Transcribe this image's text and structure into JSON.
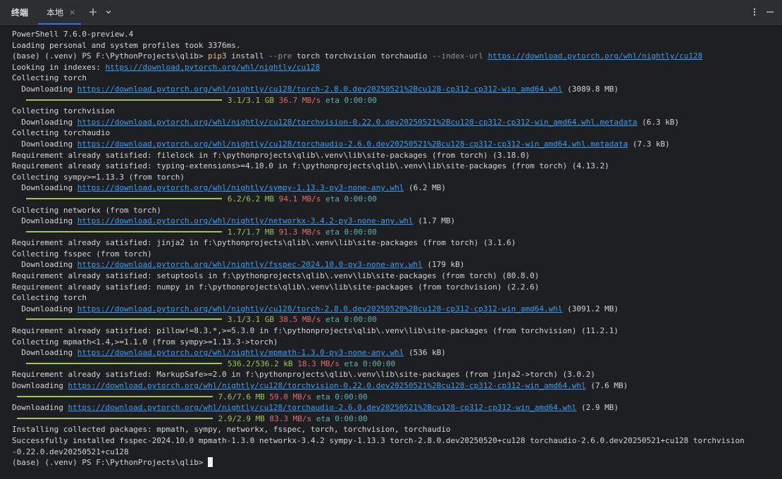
{
  "header": {
    "title": "终端",
    "tab_label": "本地",
    "close_glyph": "×",
    "new_tab_glyph": "+",
    "dropdown_glyph": "⌄",
    "more_glyph": "⋮",
    "minimize_glyph": "—"
  },
  "terminal": {
    "prompt": "(base) (.venv) PS F:\\PythonProjects\\qlib>",
    "cmd": {
      "pip": "pip3",
      "install": "install",
      "pre_flag": "--pre",
      "packages": "torch torchvision torchaudio",
      "index_flag": "--index-url",
      "index_url": "https://download.pytorch.org/whl/nightly/cu128"
    },
    "l1": "PowerShell 7.6.0-preview.4",
    "l2": "Loading personal and system profiles took 3376ms.",
    "l4_prefix": "Looking in indexes: ",
    "l4_url": "https://download.pytorch.org/whl/nightly/cu128",
    "l5": "Collecting torch",
    "dl": "Downloading",
    "u_torch1": "https://download.pytorch.org/whl/nightly/cu128/torch-2.8.0.dev20250521%2Bcu128-cp312-cp312-win_amd64.whl",
    "s_torch1": " (3089.8 MB)",
    "p_torch1": {
      "size": "3.1/3.1 GB",
      "rate": "36.7 MB/s",
      "eta": "eta 0:00:00"
    },
    "l8": "Collecting torchvision",
    "u_tv_meta": "https://download.pytorch.org/whl/nightly/cu128/torchvision-0.22.0.dev20250521%2Bcu128-cp312-cp312-win_amd64.whl.metadata",
    "s_tv_meta": " (6.3 kB)",
    "l10": "Collecting torchaudio",
    "u_ta_meta": "https://download.pytorch.org/whl/nightly/cu128/torchaudio-2.6.0.dev20250521%2Bcu128-cp312-cp312-win_amd64.whl.metadata",
    "s_ta_meta": " (7.3 kB)",
    "l12": "Requirement already satisfied: filelock in f:\\pythonprojects\\qlib\\.venv\\lib\\site-packages (from torch) (3.18.0)",
    "l13": "Requirement already satisfied: typing-extensions>=4.10.0 in f:\\pythonprojects\\qlib\\.venv\\lib\\site-packages (from torch) (4.13.2)",
    "l14": "Collecting sympy>=1.13.3 (from torch)",
    "u_sympy": "https://download.pytorch.org/whl/nightly/sympy-1.13.3-py3-none-any.whl",
    "s_sympy": " (6.2 MB)",
    "p_sympy": {
      "size": "6.2/6.2 MB",
      "rate": "94.1 MB/s",
      "eta": "eta 0:00:00"
    },
    "l17": "Collecting networkx (from torch)",
    "u_nx": "https://download.pytorch.org/whl/nightly/networkx-3.4.2-py3-none-any.whl",
    "s_nx": " (1.7 MB)",
    "p_nx": {
      "size": "1.7/1.7 MB",
      "rate": "91.3 MB/s",
      "eta": "eta 0:00:00"
    },
    "l20": "Requirement already satisfied: jinja2 in f:\\pythonprojects\\qlib\\.venv\\lib\\site-packages (from torch) (3.1.6)",
    "l21": "Collecting fsspec (from torch)",
    "u_fsspec": "https://download.pytorch.org/whl/nightly/fsspec-2024.10.0-py3-none-any.whl",
    "s_fsspec": " (179 kB)",
    "l23": "Requirement already satisfied: setuptools in f:\\pythonprojects\\qlib\\.venv\\lib\\site-packages (from torch) (80.8.0)",
    "l24": "Requirement already satisfied: numpy in f:\\pythonprojects\\qlib\\.venv\\lib\\site-packages (from torchvision) (2.2.6)",
    "l25": "Collecting torch",
    "u_torch2": "https://download.pytorch.org/whl/nightly/cu128/torch-2.8.0.dev20250520%2Bcu128-cp312-cp312-win_amd64.whl",
    "s_torch2": " (3091.2 MB)",
    "p_torch2": {
      "size": "3.1/3.1 GB",
      "rate": "38.5 MB/s",
      "eta": "eta 0:00:00"
    },
    "l28": "Requirement already satisfied: pillow!=8.3.*,>=5.3.0 in f:\\pythonprojects\\qlib\\.venv\\lib\\site-packages (from torchvision) (11.2.1)",
    "l29": "Collecting mpmath<1.4,>=1.1.0 (from sympy>=1.13.3->torch)",
    "u_mpmath": "https://download.pytorch.org/whl/nightly/mpmath-1.3.0-py3-none-any.whl",
    "s_mpmath": " (536 kB)",
    "p_mpmath": {
      "size": "536.2/536.2 kB",
      "rate": "18.3 MB/s",
      "eta": "eta 0:00:00"
    },
    "l32": "Requirement already satisfied: MarkupSafe>=2.0 in f:\\pythonprojects\\qlib\\.venv\\lib\\site-packages (from jinja2->torch) (3.0.2)",
    "u_tv": "https://download.pytorch.org/whl/nightly/cu128/torchvision-0.22.0.dev20250521%2Bcu128-cp312-cp312-win_amd64.whl",
    "s_tv": " (7.6 MB)",
    "p_tv": {
      "size": "7.6/7.6 MB",
      "rate": "59.0 MB/s",
      "eta": "eta 0:00:00"
    },
    "u_ta": "https://download.pytorch.org/whl/nightly/cu128/torchaudio-2.6.0.dev20250521%2Bcu128-cp312-cp312-win_amd64.whl",
    "s_ta": " (2.9 MB)",
    "p_ta": {
      "size": "2.9/2.9 MB",
      "rate": "83.3 MB/s",
      "eta": "eta 0:00:00"
    },
    "l37": "Installing collected packages: mpmath, sympy, networkx, fsspec, torch, torchvision, torchaudio",
    "l38": "Successfully installed fsspec-2024.10.0 mpmath-1.3.0 networkx-3.4.2 sympy-1.13.3 torch-2.8.0.dev20250520+cu128 torchaudio-2.6.0.dev20250521+cu128 torchvision",
    "l39": "-0.22.0.dev20250521+cu128"
  },
  "colors": {
    "background": "#1e1f22",
    "link": "#3d9df2",
    "progress": "#a2c45a",
    "rate": "#e06c75",
    "eta": "#5fb3b3",
    "command": "#e5c07b"
  }
}
